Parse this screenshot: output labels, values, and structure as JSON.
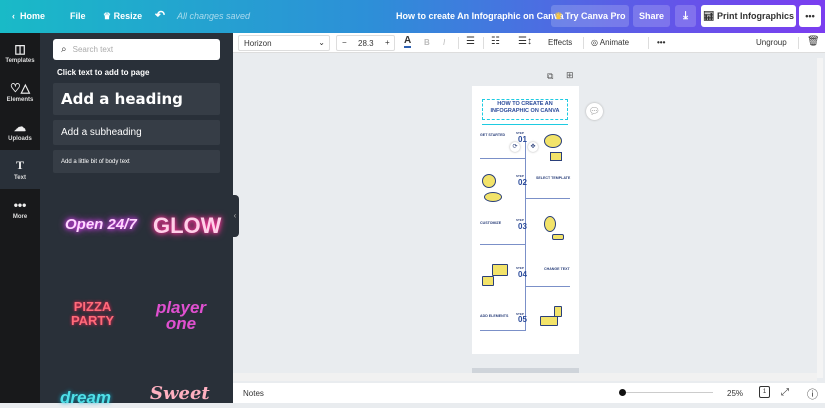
{
  "topbar": {
    "home": "Home",
    "file": "File",
    "resize": "Resize",
    "saved": "All changes saved",
    "title": "How to create An Infographic on Canva",
    "try_pro": "Try Canva Pro",
    "share": "Share",
    "print": "Print Infographics"
  },
  "rail": [
    {
      "label": "Templates"
    },
    {
      "label": "Elements"
    },
    {
      "label": "Uploads"
    },
    {
      "label": "Text"
    },
    {
      "label": "More"
    }
  ],
  "panel": {
    "search_placeholder": "Search text",
    "hint": "Click text to add to page",
    "heading": "Add a heading",
    "subheading": "Add a subheading",
    "body": "Add a little bit of body text",
    "styles": [
      "Open 24/7",
      "GLOW",
      "PIZZA PARTY",
      "player one",
      "dream",
      "Sweet"
    ]
  },
  "toolbar": {
    "font": "Horizon",
    "size": "28.3",
    "effects": "Effects",
    "animate": "Animate",
    "ungroup": "Ungroup"
  },
  "infographic": {
    "title": "HOW TO CREATE AN INFOGRAPHIC ON CANVA",
    "steps": [
      {
        "step": "STEP",
        "num": "01",
        "label": "GET STARTED"
      },
      {
        "step": "STEP",
        "num": "02",
        "label": "SELECT TEMPLATE"
      },
      {
        "step": "STEP",
        "num": "03",
        "label": "CUSTOMIZE"
      },
      {
        "step": "STEP",
        "num": "04",
        "label": "CHANGE TEXT"
      },
      {
        "step": "STEP",
        "num": "05",
        "label": "ADD ELEMENTS"
      }
    ]
  },
  "bottombar": {
    "notes": "Notes",
    "zoom": "25%",
    "page": "1",
    "zoom_fraction": 0.0
  }
}
